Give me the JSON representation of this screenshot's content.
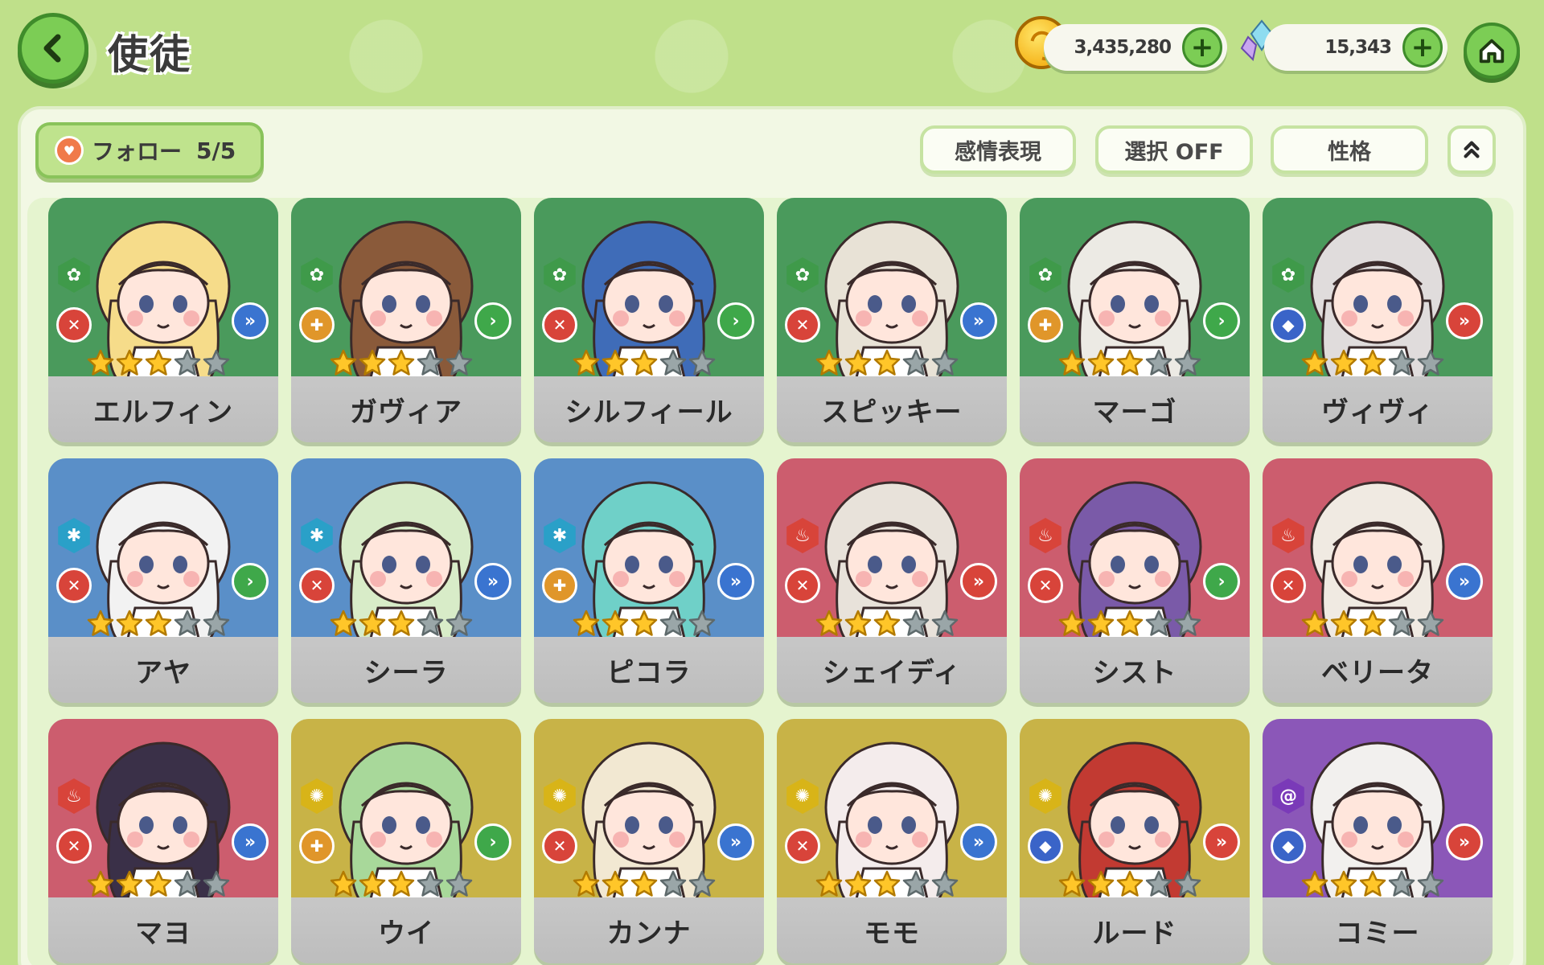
{
  "header": {
    "title": "使徒",
    "gold_amount": "3,435,280",
    "crystal_amount": "15,343"
  },
  "toolbar": {
    "follow_label": "フォロー",
    "follow_count": "5/5",
    "emotion_label": "感情表現",
    "select_label": "選択 OFF",
    "personality_label": "性格"
  },
  "colors": {
    "green_card": "#4a9a5c",
    "blue_card": "#5a8fc8",
    "red_card": "#cc5d6e",
    "yellow_card": "#c8b347",
    "purple_card": "#8b57b8"
  },
  "characters": [
    {
      "name": "エルフィン",
      "bg": "green",
      "element": "nature",
      "role": "attack",
      "arrow": "blue",
      "stars": 3,
      "hair": "#f6dc8a"
    },
    {
      "name": "ガヴィア",
      "bg": "green",
      "element": "nature",
      "role": "heal",
      "arrow": "green",
      "stars": 3,
      "hair": "#8a5a3a"
    },
    {
      "name": "シルフィール",
      "bg": "green",
      "element": "nature",
      "role": "attack",
      "arrow": "green",
      "stars": 3,
      "hair": "#3f6cb8"
    },
    {
      "name": "スピッキー",
      "bg": "green",
      "element": "nature",
      "role": "attack",
      "arrow": "blue",
      "stars": 3,
      "hair": "#e8e2d6"
    },
    {
      "name": "マーゴ",
      "bg": "green",
      "element": "nature",
      "role": "heal",
      "arrow": "green",
      "stars": 3,
      "hair": "#eceae4"
    },
    {
      "name": "ヴィヴィ",
      "bg": "green",
      "element": "nature",
      "role": "defense",
      "arrow": "red",
      "stars": 3,
      "hair": "#e0dcdc"
    },
    {
      "name": "アヤ",
      "bg": "blue",
      "element": "ice",
      "role": "attack",
      "arrow": "green",
      "stars": 3,
      "hair": "#f2f2f2"
    },
    {
      "name": "シーラ",
      "bg": "blue",
      "element": "ice",
      "role": "attack",
      "arrow": "blue",
      "stars": 3,
      "hair": "#d8ecc8"
    },
    {
      "name": "ピコラ",
      "bg": "blue",
      "element": "ice",
      "role": "heal",
      "arrow": "blue",
      "stars": 3,
      "hair": "#6fd0c8"
    },
    {
      "name": "シェイディ",
      "bg": "red",
      "element": "fire",
      "role": "attack",
      "arrow": "red",
      "stars": 3,
      "hair": "#e8e2da"
    },
    {
      "name": "シスト",
      "bg": "red",
      "element": "fire",
      "role": "attack",
      "arrow": "green",
      "stars": 3,
      "hair": "#7a5aa8"
    },
    {
      "name": "ベリータ",
      "bg": "red",
      "element": "fire",
      "role": "attack",
      "arrow": "blue",
      "stars": 3,
      "hair": "#f0eae2"
    },
    {
      "name": "マヨ",
      "bg": "red",
      "element": "fire",
      "role": "attack",
      "arrow": "blue",
      "stars": 3,
      "hair": "#3a3048"
    },
    {
      "name": "ウイ",
      "bg": "yellow",
      "element": "light",
      "role": "heal",
      "arrow": "green",
      "stars": 3,
      "hair": "#a8d89a"
    },
    {
      "name": "カンナ",
      "bg": "yellow",
      "element": "light",
      "role": "attack",
      "arrow": "blue",
      "stars": 3,
      "hair": "#f2e8d2"
    },
    {
      "name": "モモ",
      "bg": "yellow",
      "element": "light",
      "role": "attack",
      "arrow": "blue",
      "stars": 3,
      "hair": "#f4ecec"
    },
    {
      "name": "ルード",
      "bg": "yellow",
      "element": "light",
      "role": "defense",
      "arrow": "red",
      "stars": 3,
      "hair": "#c23a32"
    },
    {
      "name": "コミー",
      "bg": "purple",
      "element": "void",
      "role": "defense",
      "arrow": "red",
      "stars": 3,
      "hair": "#f2f0ee"
    }
  ]
}
